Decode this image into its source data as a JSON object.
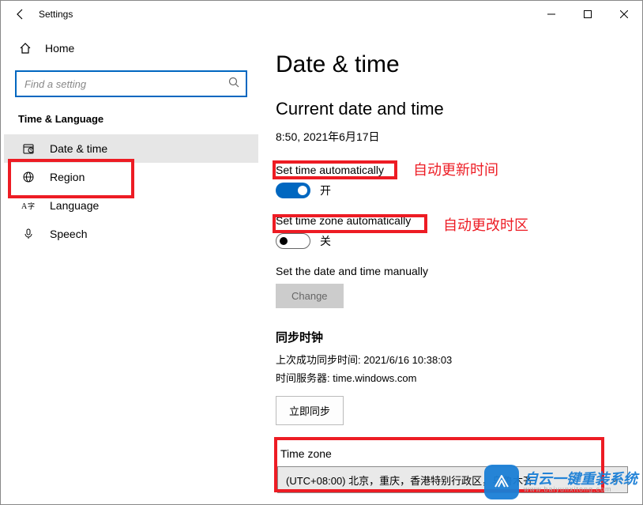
{
  "window": {
    "title": "Settings"
  },
  "sidebar": {
    "home": "Home",
    "search_placeholder": "Find a setting",
    "section": "Time & Language",
    "items": [
      {
        "label": "Date & time",
        "icon": "clock"
      },
      {
        "label": "Region",
        "icon": "globe"
      },
      {
        "label": "Language",
        "icon": "lang"
      },
      {
        "label": "Speech",
        "icon": "mic"
      }
    ]
  },
  "content": {
    "heading": "Date & time",
    "current_heading": "Current date and time",
    "current_value": "8:50, 2021年6月17日",
    "set_time_auto_label": "Set time automatically",
    "set_time_auto_state": "开",
    "set_tz_auto_label": "Set time zone automatically",
    "set_tz_auto_state": "关",
    "manual_label": "Set the date and time manually",
    "change_button": "Change",
    "sync_heading": "同步时钟",
    "sync_last": "上次成功同步时间: 2021/6/16 10:38:03",
    "sync_server": "时间服务器: time.windows.com",
    "sync_now_button": "立即同步",
    "tz_label": "Time zone",
    "tz_value": "(UTC+08:00) 北京，重庆，香港特别行政区，乌鲁木齐"
  },
  "annotations": {
    "auto_time": "自动更新时间",
    "auto_tz": "自动更改时区"
  },
  "watermark": {
    "brand": "自云一键重装系统",
    "url": "www.baiyunxitong.com"
  }
}
